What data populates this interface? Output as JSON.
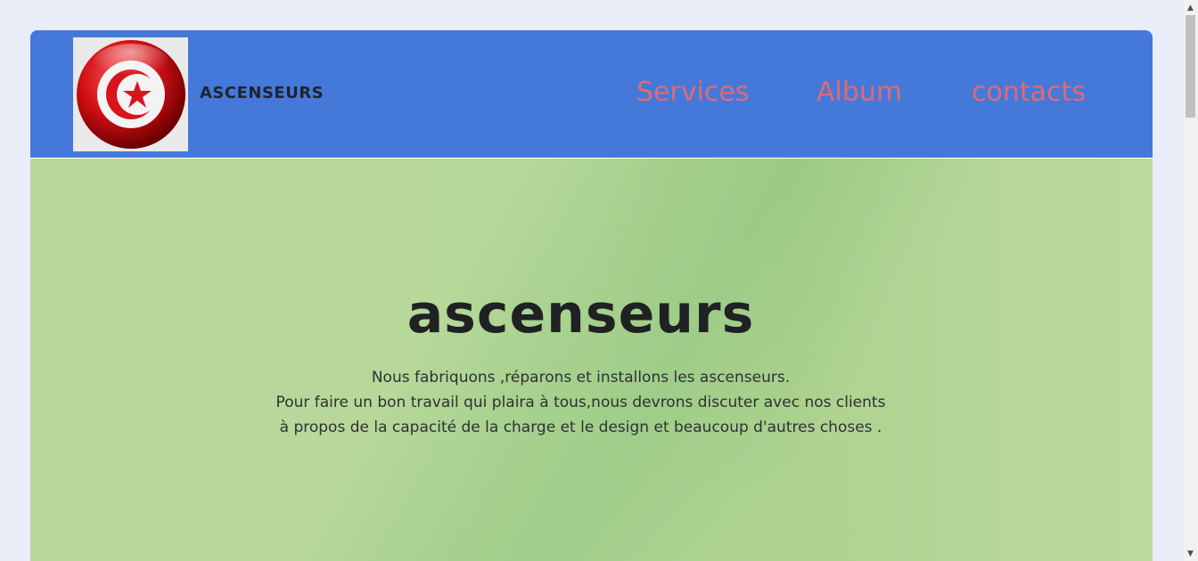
{
  "header": {
    "brand": "ASCENSEURS",
    "logo_icon": "tunisia-flag-icon",
    "nav": [
      {
        "label": "Services"
      },
      {
        "label": "Album"
      },
      {
        "label": "contacts"
      }
    ]
  },
  "hero": {
    "title": "ascenseurs",
    "lines": [
      "Nous fabriquons ,réparons et installons les ascenseurs.",
      "Pour faire un bon travail qui plaira à tous,nous devrons discuter avec nos clients",
      "à propos de la capacité de la charge et le design et beaucoup d'autres choses ."
    ]
  },
  "colors": {
    "header_bg": "#4479d9",
    "nav_text": "#e06a73",
    "hero_bg": "#b8d89b",
    "page_bg": "#e8edf8"
  }
}
